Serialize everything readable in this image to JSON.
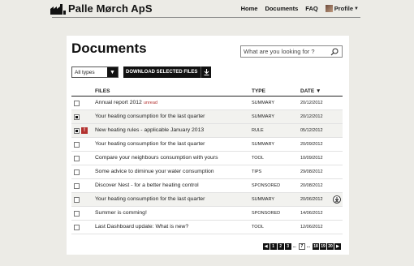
{
  "header": {
    "brand": "Palle Mørch ApS",
    "nav": [
      "Home",
      "Documents",
      "FAQ"
    ],
    "profile_label": "Profile"
  },
  "page": {
    "title": "Documents",
    "search_placeholder": "What are you looking for ?"
  },
  "toolbar": {
    "filter_selected": "All types",
    "download_label": "DOWNLOAD SELECTED FILES"
  },
  "table": {
    "headers": {
      "files": "FILES",
      "type": "TYPE",
      "date": "DATE ▼"
    },
    "rows": [
      {
        "file": "Annual report 2012",
        "badge": "unread",
        "type": "SUMMARY",
        "date": "20/12/2012"
      },
      {
        "file": "Your heating consumption for the last quarter",
        "type": "SUMMARY",
        "date": "20/12/2012"
      },
      {
        "file": "New heating rules - applicable January 2013",
        "type": "RULE",
        "date": "05/12/2012"
      },
      {
        "file": "Your heating consumption for the last quarter",
        "type": "SUMMARY",
        "date": "20/09/2012"
      },
      {
        "file": "Compare your neighbours consumption with yours",
        "type": "TOOL",
        "date": "10/09/2012"
      },
      {
        "file": "Some advice to diminue your water consumption",
        "type": "TIPS",
        "date": "29/08/2012"
      },
      {
        "file": "Discover Nest - for a better heating control",
        "type": "SPONSORED",
        "date": "20/08/2012"
      },
      {
        "file": "Your heating consumption for the last quarter",
        "type": "SUMMARY",
        "date": "20/06/2012"
      },
      {
        "file": "Summer is comming!",
        "type": "SPONSORED",
        "date": "14/06/2012"
      },
      {
        "file": "Last Dashboard update: What is new?",
        "type": "TOOL",
        "date": "12/06/2012"
      }
    ]
  },
  "pagination": {
    "prev": "◀",
    "pages_start": [
      "1",
      "2",
      "3"
    ],
    "ellipsis": "...",
    "current": "7",
    "pages_end": [
      "18",
      "19",
      "20"
    ],
    "next": "▶"
  },
  "colors": {
    "accent_red": "#b3312f",
    "dark": "#111111",
    "background": "#ecebe6"
  },
  "icons": [
    "factory-logo-icon",
    "search-icon",
    "chevron-down-icon",
    "download-icon",
    "warning-icon",
    "download-circle-icon"
  ]
}
